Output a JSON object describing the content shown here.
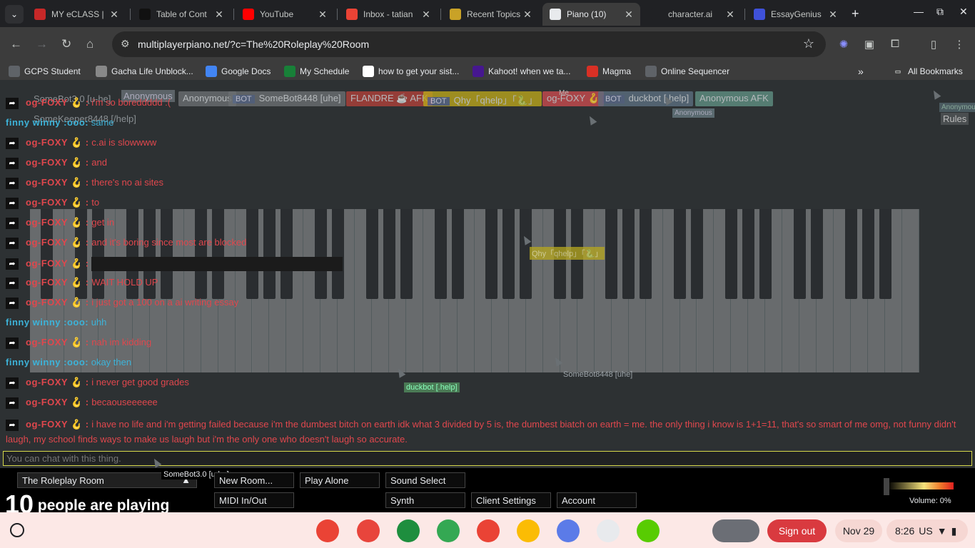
{
  "browser": {
    "tabs": [
      {
        "title": "MY eCLASS | ",
        "icon": "eclass-icon",
        "color": "#c62828"
      },
      {
        "title": "Table of Cont",
        "icon": "d2l-icon",
        "color": "#111111"
      },
      {
        "title": "YouTube",
        "icon": "youtube-icon",
        "color": "#ff0000"
      },
      {
        "title": "Inbox - tatian",
        "icon": "gmail-icon",
        "color": "#ea4335"
      },
      {
        "title": "Recent Topics",
        "icon": "music-note-icon",
        "color": "#c9a227"
      },
      {
        "title": "Piano (10)",
        "icon": "piano-icon",
        "color": "#e8eaed"
      },
      {
        "title": "character.ai",
        "icon": "cai-icon",
        "color": "#202124"
      },
      {
        "title": "EssayGenius",
        "icon": "feather-icon",
        "color": "#3f51d9"
      }
    ],
    "active_tab": 5,
    "url": "multiplayerpiano.net/?c=The%20Roleplay%20Room",
    "bookmarks": [
      {
        "label": "GCPS Student",
        "icon": "folder-icon"
      },
      {
        "label": "Gacha Life Unblock...",
        "icon": "gacha-icon"
      },
      {
        "label": "Google Docs",
        "icon": "docs-icon"
      },
      {
        "label": "My Schedule",
        "icon": "schedule-icon"
      },
      {
        "label": "how to get your sist...",
        "icon": "google-icon"
      },
      {
        "label": "Kahoot! when we ta...",
        "icon": "kahoot-icon"
      },
      {
        "label": "Magma",
        "icon": "magma-icon"
      },
      {
        "label": "Online Sequencer",
        "icon": "sequencer-icon"
      }
    ],
    "all_bookmarks": "All Bookmarks"
  },
  "participants": [
    {
      "name": "Anonymous",
      "bot": false,
      "color": "#6b6f72"
    },
    {
      "name": "SomeBot8448 [uhe]",
      "bot": true,
      "color": "#6b6f72"
    },
    {
      "name": "FLANDRE ☕ AFK",
      "bot": false,
      "color": "#b0403a"
    },
    {
      "name": "Qhy「qhelp」「🐍」",
      "bot": true,
      "color": "#b9a51c"
    },
    {
      "name": "og-FOXY 🪝",
      "bot": false,
      "color": "#c94a4e"
    },
    {
      "name": "duckbot [.help]",
      "bot": true,
      "color": "#5c6f80"
    },
    {
      "name": "Anonymous AFK",
      "bot": false,
      "color": "#5f8f82"
    }
  ],
  "header_ghosts": {
    "bot1": "SomeBot3.0 [u-he]",
    "anon": "Anonymous",
    "keeper": "SomeKeeper8448 [/help]",
    "me": "Me",
    "rules": "Rules",
    "anon2": "Anonymous",
    "anon3": "Anonymous"
  },
  "chat": [
    {
      "name": "og-FOXY 🪝 :",
      "text": "i'm so boreddddd :(",
      "color": "red"
    },
    {
      "name": "finny winny :ooo:",
      "text": "same",
      "color": "blue"
    },
    {
      "name": "og-FOXY 🪝 :",
      "text": "c.ai is slowwww",
      "color": "red"
    },
    {
      "name": "og-FOXY 🪝 :",
      "text": "and",
      "color": "red"
    },
    {
      "name": "og-FOXY 🪝 :",
      "text": "there's no ai sites",
      "color": "red"
    },
    {
      "name": "og-FOXY 🪝 :",
      "text": "to",
      "color": "red"
    },
    {
      "name": "og-FOXY 🪝 :",
      "text": "get in",
      "color": "red"
    },
    {
      "name": "og-FOXY 🪝 :",
      "text": "and it's boring since most are blocked",
      "color": "red"
    },
    {
      "name": "og-FOXY 🪝 :",
      "text": "",
      "color": "red",
      "redacted": true
    },
    {
      "name": "og-FOXY 🪝 :",
      "text": "WAIT HOLD UP",
      "color": "red"
    },
    {
      "name": "og-FOXY 🪝 :",
      "text": "i just got a 100 on a ai writing essay",
      "color": "red"
    },
    {
      "name": "finny winny :ooo:",
      "text": "uhh",
      "color": "blue"
    },
    {
      "name": "og-FOXY 🪝 :",
      "text": "nah im kidding",
      "color": "red"
    },
    {
      "name": "finny winny :ooo:",
      "text": "okay then",
      "color": "blue"
    },
    {
      "name": "og-FOXY 🪝 :",
      "text": "i never get good grades",
      "color": "red"
    },
    {
      "name": "og-FOXY 🪝 :",
      "text": "becaouseeeeee",
      "color": "red"
    },
    {
      "name": "og-FOXY 🪝 :",
      "text": "i have no life and i'm getting failed because i'm the dumbest bitch on earth idk what 3 divided by 5 is, the dumbest biatch on earth = me. the only thing i know is 1+1=11, that's so smart of me omg, not funny didn't laugh, my school finds ways to make us laugh but i'm the only one who doesn't laugh so accurate.",
      "color": "red"
    }
  ],
  "cursors": {
    "qhy": "Qhy「qhelp」「🐍」",
    "duckbot": "duckbot [.help]",
    "somebot": "SomeBot8448 [uhe]",
    "somebot3": "SomeBot3.0 [u-he]"
  },
  "chat_input": {
    "placeholder": "You can chat with this thing."
  },
  "bottom": {
    "room": "The Roleplay Room",
    "people_count": "10",
    "people_text": "people are playing",
    "buttons": {
      "new_room": "New Room...",
      "play_alone": "Play Alone",
      "sound_select": "Sound Select",
      "midi": "MIDI In/Out",
      "synth": "Synth",
      "client_settings": "Client Settings",
      "account": "Account"
    },
    "volume": "Volume: 0%"
  },
  "shelf": {
    "apps": [
      "chrome-icon",
      "canvas-icon",
      "classroom-icon",
      "drive-icon",
      "clock-icon",
      "keep-icon",
      "emoji-icon",
      "pen-icon",
      "duolingo-icon"
    ],
    "sign_out": "Sign out",
    "date": "Nov 29",
    "time": "8:26",
    "locale": "US"
  }
}
